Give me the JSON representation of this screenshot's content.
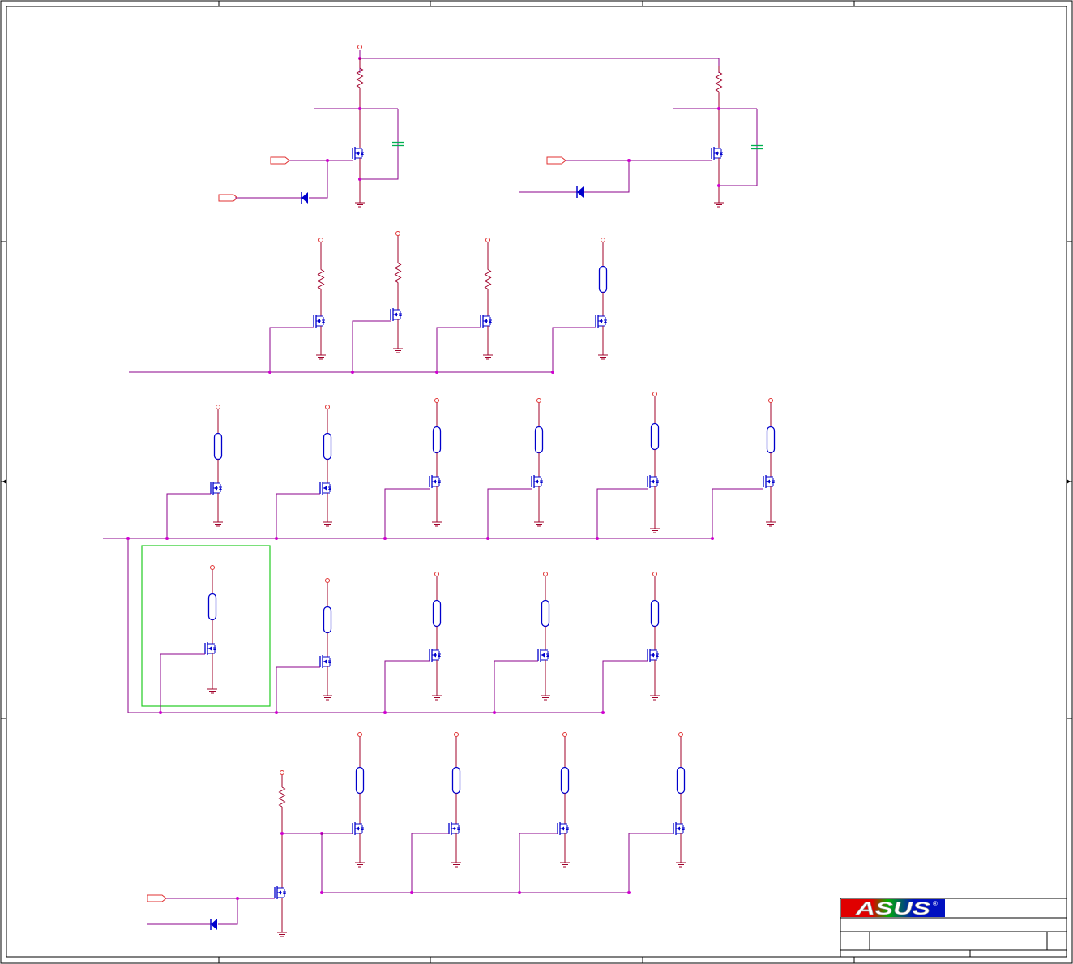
{
  "logo": {
    "text": "ASUS",
    "registered_mark": "®"
  },
  "colors": {
    "wire": "#8b008b",
    "power": "#a0002a",
    "device": "#0000cc",
    "capacitor": "#00b050",
    "junction": "#d000d0",
    "highlight": "#22cc22",
    "frame": "#000000",
    "port": "#e03030"
  },
  "circuit": {
    "rows": [
      {
        "name": "row-1",
        "transistors": 2,
        "load": "resistor",
        "inputs": 2
      },
      {
        "name": "row-2",
        "transistors": 4,
        "load": "resistor-and-led"
      },
      {
        "name": "row-3",
        "transistors": 6,
        "load": "led"
      },
      {
        "name": "row-4",
        "transistors": 5,
        "load": "led",
        "highlighted": 1
      },
      {
        "name": "row-5",
        "transistors": 4,
        "load": "led",
        "driver": 1
      }
    ]
  }
}
